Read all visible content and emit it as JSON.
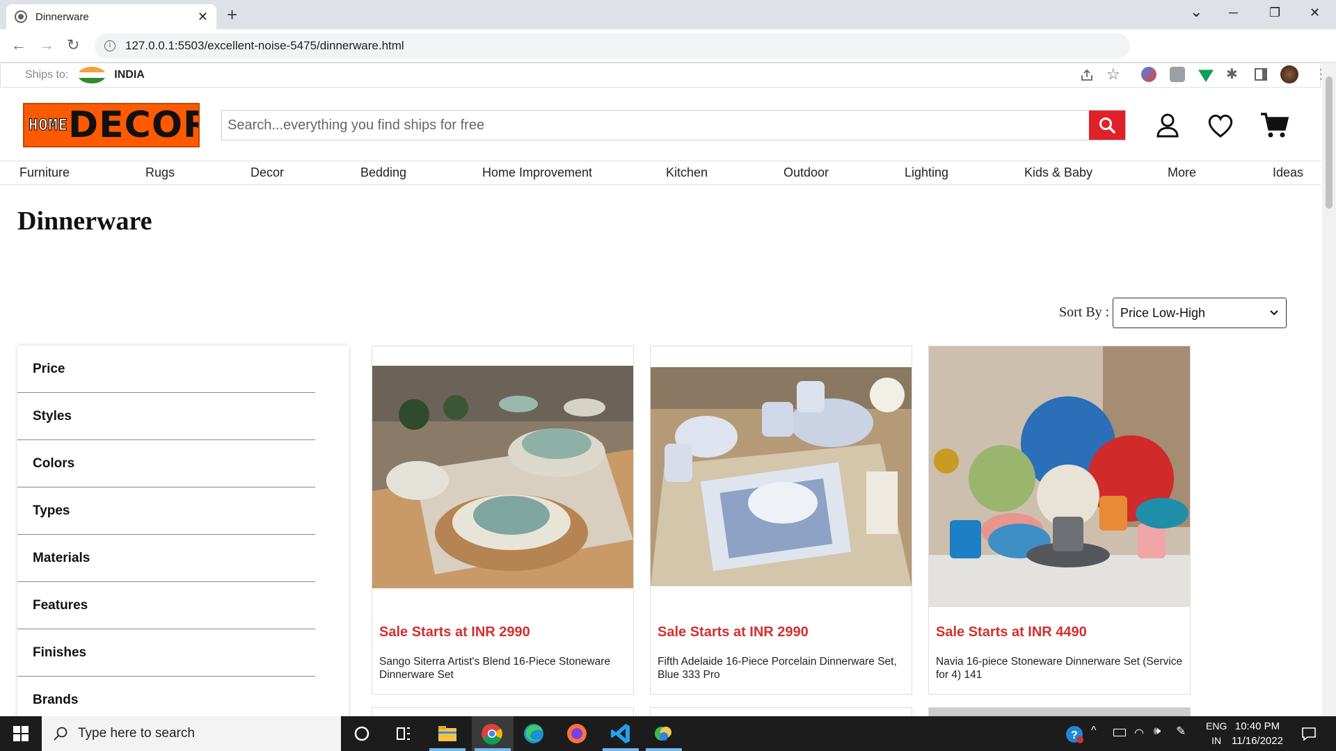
{
  "browser": {
    "tab_title": "Dinnerware",
    "tab_close": "✕",
    "new_tab": "+",
    "url": "127.0.0.1:5503/excellent-noise-5475/dinnerware.html",
    "min": "─",
    "restore": "❐",
    "close": "✕",
    "dropdown": "⌄"
  },
  "ship": {
    "label": "Ships to:",
    "country": "INDIA"
  },
  "logo": {
    "part1": "HOME",
    "part2": "DECOR"
  },
  "search": {
    "placeholder": "Search...everything you find ships for free"
  },
  "categories": [
    "Furniture",
    "Rugs",
    "Decor",
    "Bedding",
    "Home Improvement",
    "Kitchen",
    "Outdoor",
    "Lighting",
    "Kids & Baby",
    "More",
    "Ideas"
  ],
  "page_title": "Dinnerware",
  "sort": {
    "label": "Sort By :",
    "selected": "Price Low-High"
  },
  "filters": [
    "Price",
    "Styles",
    "Colors",
    "Types",
    "Materials",
    "Features",
    "Finishes",
    "Brands"
  ],
  "products": [
    {
      "price": "Sale Starts at INR 2990",
      "name": "Sango Siterra Artist's Blend 16-Piece Stoneware Dinnerware Set"
    },
    {
      "price": "Sale Starts at INR 2990",
      "name": "Fifth Adelaide 16-Piece Porcelain Dinnerware Set, Blue 333 Pro"
    },
    {
      "price": "Sale Starts at INR 4490",
      "name": "Navia 16-piece Stoneware Dinnerware Set (Service for 4) 141"
    }
  ],
  "taskbar": {
    "search_placeholder": "Type here to search",
    "lang1": "ENG",
    "lang2": "IN",
    "time": "10:40 PM",
    "date": "11/16/2022"
  },
  "colors": {
    "brand": "#ff5a00",
    "accent_red": "#e0212a",
    "price_red": "#d32f2f"
  }
}
